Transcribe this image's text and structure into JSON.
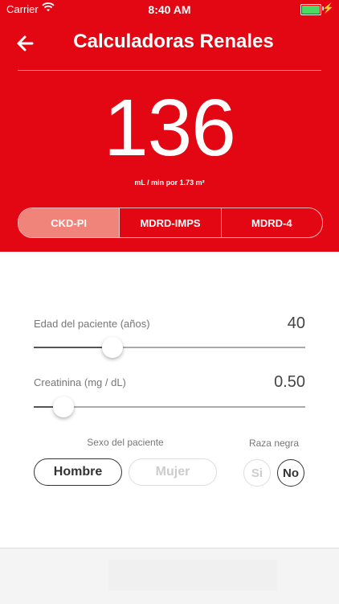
{
  "status_bar": {
    "carrier": "Carrier",
    "time": "8:40 AM"
  },
  "header": {
    "title": "Calculadoras Renales",
    "result": "136",
    "unit": "mL / min  por 1.73 m²"
  },
  "tabs": [
    {
      "label": "CKD-PI",
      "active": true
    },
    {
      "label": "MDRD-IMPS",
      "active": false
    },
    {
      "label": "MDRD-4",
      "active": false
    }
  ],
  "age": {
    "label": "Edad del paciente (años)",
    "value": "40",
    "position": 0.29
  },
  "creatinine": {
    "label": "Creatinina (mg / dL)",
    "value": "0.50",
    "position": 0.11
  },
  "sex": {
    "caption": "Sexo del paciente",
    "male": "Hombre",
    "female": "Mujer",
    "selected": "Hombre"
  },
  "race": {
    "caption": "Raza negra",
    "yes": "Si",
    "no": "No",
    "selected": "No"
  },
  "colors": {
    "primary": "#e30613",
    "active_tab": "#f0847b",
    "battery": "#4cd964"
  }
}
